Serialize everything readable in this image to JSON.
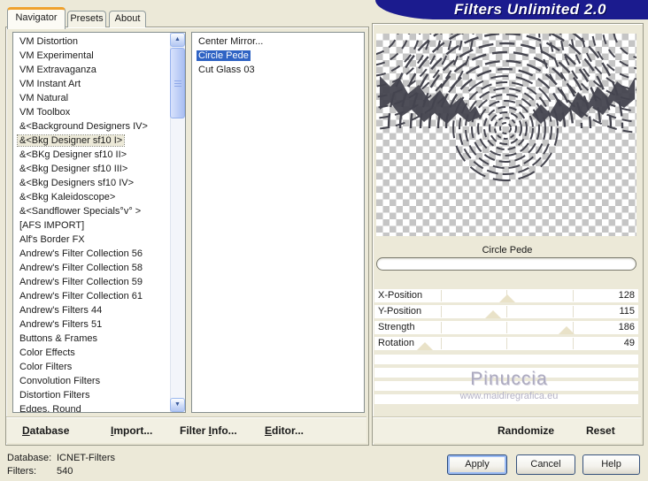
{
  "window": {
    "title": "Filters Unlimited 2.0"
  },
  "tabs": [
    {
      "label": "Navigator",
      "active": true
    },
    {
      "label": "Presets",
      "active": false
    },
    {
      "label": "About",
      "active": false
    }
  ],
  "category_list": {
    "highlight_index": 7,
    "items": [
      "VM Distortion",
      "VM Experimental",
      "VM Extravaganza",
      "VM Instant Art",
      "VM Natural",
      "VM Toolbox",
      "&<Background Designers IV>",
      "&<Bkg Designer sf10 I>",
      "&<BKg Designer sf10 II>",
      "&<Bkg Designer sf10 III>",
      "&<Bkg Designers sf10 IV>",
      "&<Bkg Kaleidoscope>",
      "&<Sandflower Specials°v° >",
      "[AFS IMPORT]",
      "Alf's Border FX",
      "Andrew's Filter Collection 56",
      "Andrew's Filter Collection 58",
      "Andrew's Filter Collection 59",
      "Andrew's Filter Collection 61",
      "Andrew's Filters 44",
      "Andrew's Filters 51",
      "Buttons & Frames",
      "Color Effects",
      "Color Filters",
      "Convolution Filters",
      "Distortion Filters",
      "Edges, Round"
    ]
  },
  "filter_list": {
    "selected_index": 1,
    "items": [
      "Center Mirror...",
      "Circle Pede",
      "Cut Glass 03"
    ]
  },
  "left_buttons": [
    {
      "label": "Database",
      "mnemonic_index": 0
    },
    {
      "label": "Import...",
      "mnemonic_index": 0
    },
    {
      "label": "Filter Info...",
      "mnemonic_index": 7
    },
    {
      "label": "Editor...",
      "mnemonic_index": 0
    }
  ],
  "preview": {
    "filter_name": "Circle Pede",
    "progress_percent": 0
  },
  "sliders": {
    "max": 255,
    "rows": [
      {
        "label": "X-Position",
        "value": 128
      },
      {
        "label": "Y-Position",
        "value": 115
      },
      {
        "label": "Strength",
        "value": 186
      },
      {
        "label": "Rotation",
        "value": 49
      }
    ]
  },
  "watermark": {
    "line1": "Pinuccia",
    "line2": "www.maidiregrafica.eu"
  },
  "right_buttons": {
    "randomize": "Randomize",
    "reset": "Reset"
  },
  "status": {
    "database_label": "Database:",
    "database_value": "ICNET-Filters",
    "filters_label": "Filters:",
    "filters_value": "540"
  },
  "dialog_buttons": {
    "apply": "Apply",
    "cancel": "Cancel",
    "help": "Help"
  },
  "colors": {
    "banner_navy": "#1b1b8e",
    "selection_blue": "#2f63c4",
    "active_tab_orange": "#efa12d",
    "window_beige": "#ece9d8",
    "thumb_tan": "#e9e2c8",
    "ripple_ink": "#45454f"
  }
}
